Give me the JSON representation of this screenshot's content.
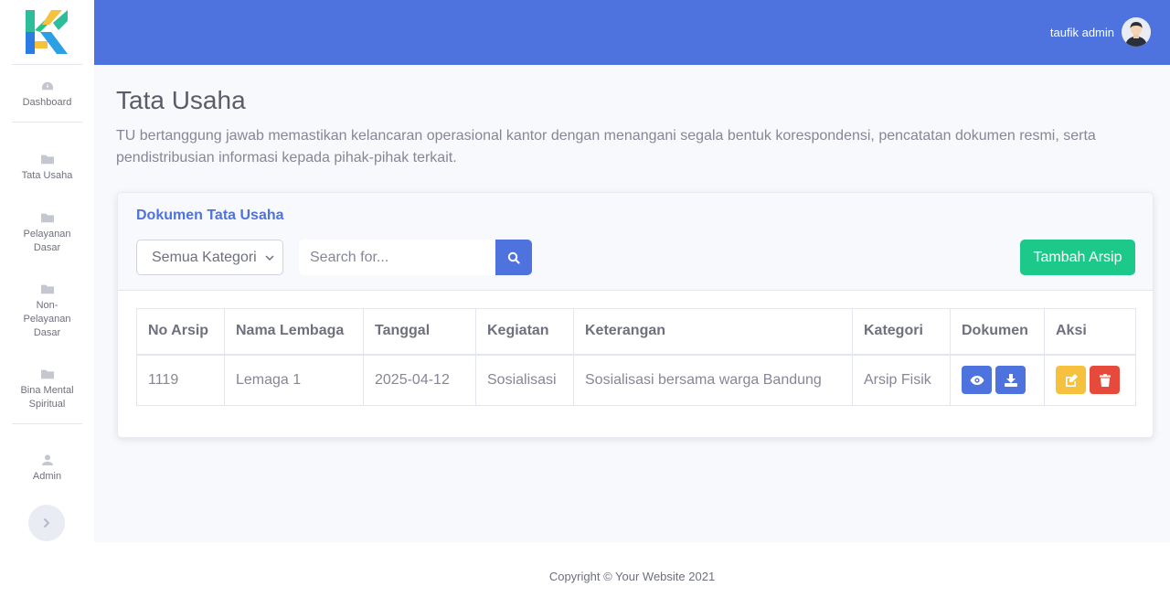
{
  "sidebar": {
    "items": [
      {
        "label": "Dashboard",
        "icon": "dashboard-icon"
      },
      {
        "label": "Tata Usaha",
        "icon": "folder-icon"
      },
      {
        "label": "Pelayanan Dasar",
        "icon": "folder-icon"
      },
      {
        "label": "Non-Pelayanan Dasar",
        "icon": "folder-icon"
      },
      {
        "label": "Bina Mental Spiritual",
        "icon": "folder-icon"
      },
      {
        "label": "Admin",
        "icon": "user-icon"
      }
    ]
  },
  "topbar": {
    "user_name": "taufik admin"
  },
  "page": {
    "title": "Tata Usaha",
    "description": "TU bertanggung jawab memastikan kelancaran operasional kantor dengan menangani segala bentuk korespondensi, pencatatan dokumen resmi, serta pendistribusian informasi kepada pihak-pihak terkait."
  },
  "card": {
    "title": "Dokumen Tata Usaha",
    "category_select": "Semua Kategori",
    "search_placeholder": "Search for...",
    "add_button": "Tambah Arsip"
  },
  "table": {
    "headers": [
      "No Arsip",
      "Nama Lembaga",
      "Tanggal",
      "Kegiatan",
      "Keterangan",
      "Kategori",
      "Dokumen",
      "Aksi"
    ],
    "rows": [
      {
        "no_arsip": "1119",
        "nama_lembaga": "Lemaga 1",
        "tanggal": "2025-04-12",
        "kegiatan": "Sosialisasi",
        "keterangan": "Sosialisasi bersama warga Bandung",
        "kategori": "Arsip Fisik"
      }
    ]
  },
  "footer": {
    "text": "Copyright © Your Website 2021"
  },
  "colors": {
    "primary": "#4e73df",
    "success": "#1cc88a",
    "warning": "#f6c23e",
    "danger": "#e74a3b"
  }
}
